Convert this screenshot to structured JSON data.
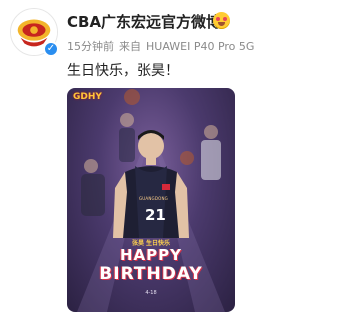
{
  "account": {
    "name": "CBA广东宏远官方微博",
    "avatar_icon": "team-logo-icon",
    "verified_icon": "verified-check-icon",
    "badge_icon": "heart-eyes-emoji-icon"
  },
  "meta": {
    "time": "15分钟前",
    "source_prefix": "来自",
    "device": "HUAWEI P40 Pro 5G"
  },
  "post": {
    "text": "生日快乐，张昊！"
  },
  "poster": {
    "logo_text": "GDHY",
    "jersey_team": "GUANGDONG",
    "jersey_number": "21",
    "caption": "张昊  生日快乐",
    "headline_1": "HAPPY",
    "headline_2": "BIRTHDAY",
    "date": "4-18"
  },
  "colors": {
    "poster_bg": "#4b3a6d",
    "headline_shadow": "#d2324a",
    "verified": "#2a8ef0"
  }
}
